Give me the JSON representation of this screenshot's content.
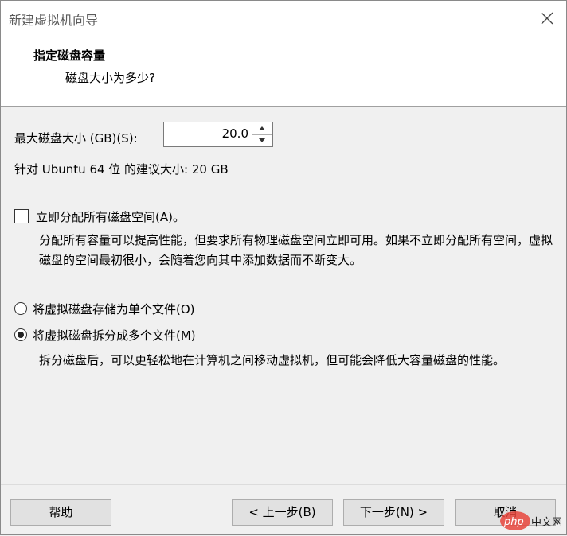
{
  "window": {
    "title": "新建虚拟机向导"
  },
  "header": {
    "title": "指定磁盘容量",
    "subtitle": "磁盘大小为多少?"
  },
  "disk_size": {
    "label": "最大磁盘大小 (GB)(S):",
    "value": "20.0"
  },
  "recommend_text": "针对 Ubuntu 64 位 的建议大小: 20 GB",
  "allocate": {
    "label": "立即分配所有磁盘空间(A)。",
    "checked": false,
    "description": "分配所有容量可以提高性能，但要求所有物理磁盘空间立即可用。如果不立即分配所有空间，虚拟磁盘的空间最初很小，会随着您向其中添加数据而不断变大。"
  },
  "storage_options": [
    {
      "label": "将虚拟磁盘存储为单个文件(O)",
      "selected": false
    },
    {
      "label": "将虚拟磁盘拆分成多个文件(M)",
      "selected": true
    }
  ],
  "split_description": "拆分磁盘后，可以更轻松地在计算机之间移动虚拟机，但可能会降低大容量磁盘的性能。",
  "buttons": {
    "help": "帮助",
    "back": "< 上一步(B)",
    "next": "下一步(N) >",
    "cancel": "取消"
  },
  "watermark": {
    "text_left": "php",
    "text_right": "中文网",
    "color_left": "#e8453c",
    "color_right": "#1a1a1a"
  }
}
